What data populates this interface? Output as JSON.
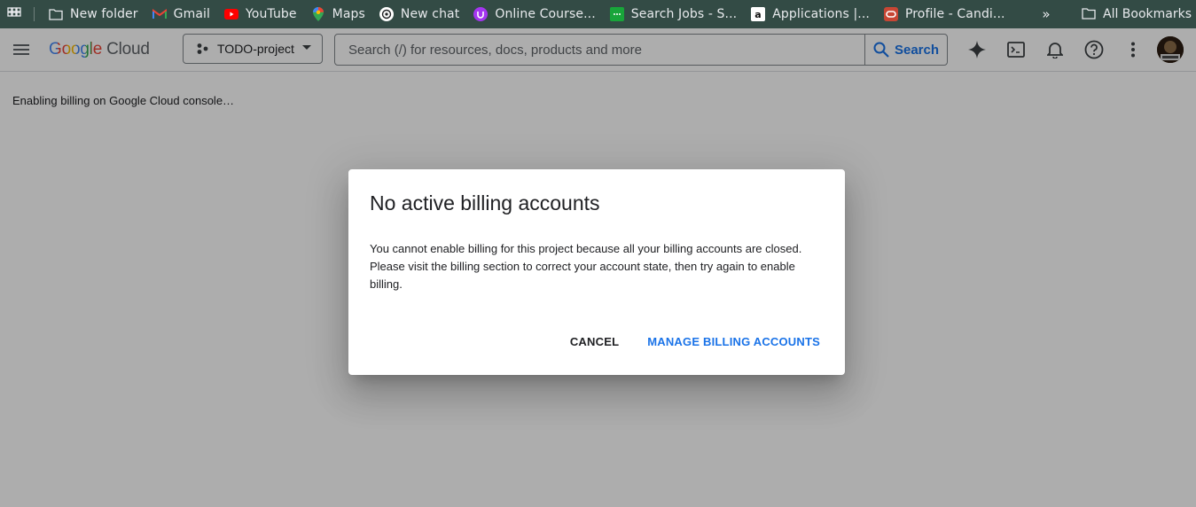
{
  "bookmarks": {
    "items": [
      {
        "label": "New folder",
        "icon": "folder-icon"
      },
      {
        "label": "Gmail",
        "icon": "gmail-icon"
      },
      {
        "label": "YouTube",
        "icon": "youtube-icon"
      },
      {
        "label": "Maps",
        "icon": "maps-icon"
      },
      {
        "label": "New chat",
        "icon": "openai-icon"
      },
      {
        "label": "Online Course...",
        "icon": "udemy-icon"
      },
      {
        "label": "Search Jobs - S...",
        "icon": "jobs-icon"
      },
      {
        "label": "Applications |...",
        "icon": "amazon-icon"
      },
      {
        "label": "Profile - Candi...",
        "icon": "oracle-icon"
      }
    ],
    "more_label": "»",
    "all_label": "All Bookmarks"
  },
  "header": {
    "logo_word1": "Google",
    "logo_word2": "Cloud",
    "project": "TODO-project",
    "search_placeholder": "Search (/) for resources, docs, products and more",
    "search_button": "Search"
  },
  "content": {
    "status": "Enabling billing on Google Cloud console…"
  },
  "dialog": {
    "title": "No active billing accounts",
    "body": "You cannot enable billing for this project because all your billing accounts are closed. Please visit the billing section to correct your account state, then try again to enable billing.",
    "cancel": "CANCEL",
    "manage": "MANAGE BILLING ACCOUNTS"
  },
  "colors": {
    "bookmark_bar": "#334b45",
    "accent": "#1a73e8",
    "scrim": "rgba(0,0,0,0.32)"
  }
}
